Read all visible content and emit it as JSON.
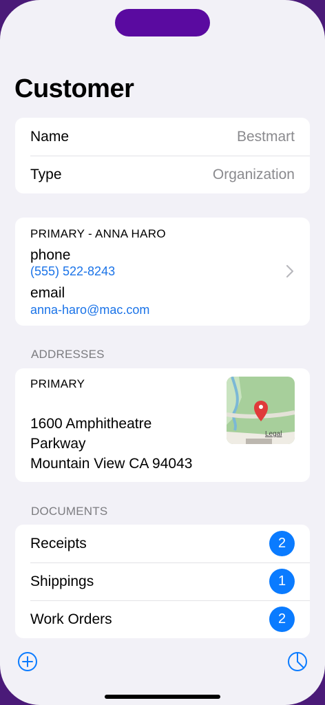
{
  "page": {
    "title": "Customer"
  },
  "info": {
    "name_label": "Name",
    "name_value": "Bestmart",
    "type_label": "Type",
    "type_value": "Organization"
  },
  "contact": {
    "header": "PRIMARY - ANNA HARO",
    "phone_label": "phone",
    "phone_value": "(555) 522-8243",
    "email_label": "email",
    "email_value": "anna-haro@mac.com",
    "chevron_icon": "chevron-right-icon"
  },
  "addresses": {
    "section_title": "ADDRESSES",
    "label": "PRIMARY",
    "line1": "1600 Amphitheatre",
    "line2": "Parkway",
    "line3": "Mountain View CA 94043",
    "map_legal": "Legal"
  },
  "documents": {
    "section_title": "DOCUMENTS",
    "items": [
      {
        "label": "Receipts",
        "count": "2"
      },
      {
        "label": "Shippings",
        "count": "1"
      },
      {
        "label": "Work Orders",
        "count": "2"
      }
    ]
  },
  "toolbar": {
    "add_icon": "plus-circle-icon",
    "chart_icon": "pie-chart-icon"
  },
  "colors": {
    "accent": "#0a7bff",
    "link": "#1a73e8",
    "background": "#f2f1f7",
    "frame": "#5a0aa0"
  }
}
